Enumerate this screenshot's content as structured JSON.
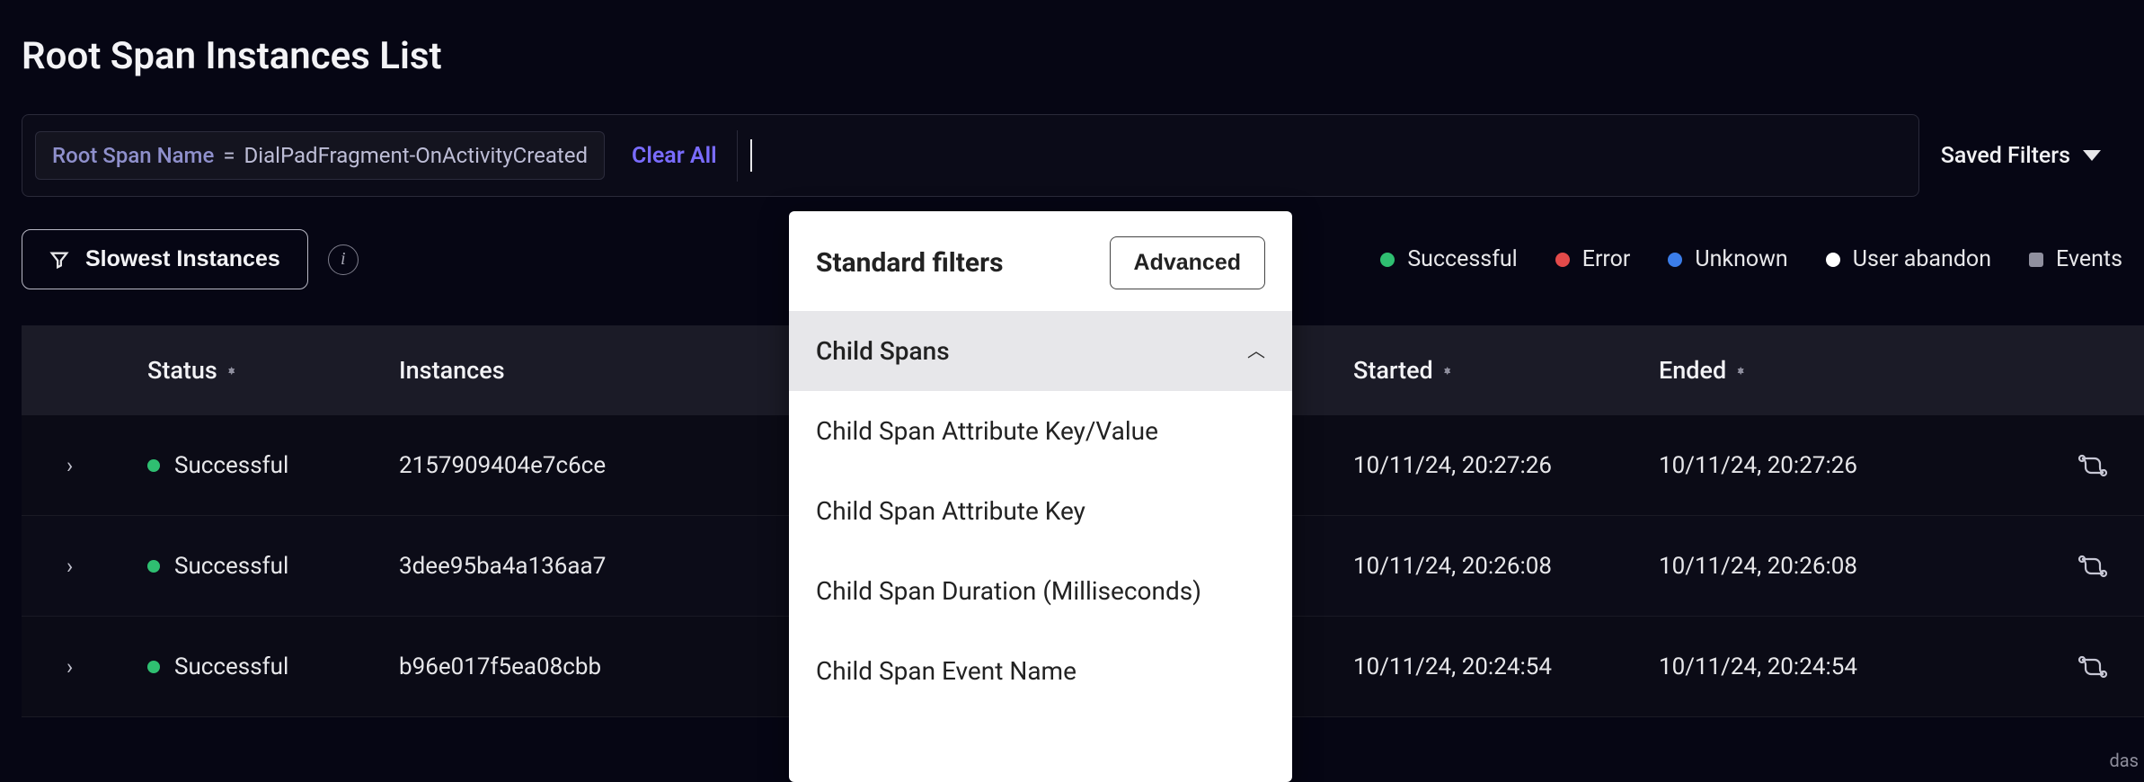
{
  "page_title": "Root Span Instances List",
  "filter_bar": {
    "chip": {
      "key": "Root Span Name",
      "op": "=",
      "value": "DialPadFragment-OnActivityCreated"
    },
    "clear_all": "Clear All"
  },
  "saved_filters": {
    "label": "Saved Filters"
  },
  "slowest_button": "Slowest Instances",
  "legend": {
    "successful": "Successful",
    "error": "Error",
    "unknown": "Unknown",
    "user_abandon": "User abandon",
    "events": "Events"
  },
  "colors": {
    "successful": "#2fbf71",
    "error": "#e34a4a",
    "unknown": "#3b7de9",
    "user_abandon": "#ffffff",
    "events": "#8f8f9e"
  },
  "table": {
    "headers": {
      "status": "Status",
      "instances": "Instances",
      "started": "Started",
      "ended": "Ended"
    },
    "rows": [
      {
        "status": "Successful",
        "instance_id": "2157909404e7c6ce",
        "started": "10/11/24, 20:27:26",
        "ended": "10/11/24, 20:27:26"
      },
      {
        "status": "Successful",
        "instance_id": "3dee95ba4a136aa7",
        "started": "10/11/24, 20:26:08",
        "ended": "10/11/24, 20:26:08"
      },
      {
        "status": "Successful",
        "instance_id": "b96e017f5ea08cbb",
        "started": "10/11/24, 20:24:54",
        "ended": "10/11/24, 20:24:54"
      }
    ]
  },
  "dropdown": {
    "title": "Standard filters",
    "advanced": "Advanced",
    "group": "Child Spans",
    "items": [
      "Child Span Attribute Key/Value",
      "Child Span Attribute Key",
      "Child Span Duration (Milliseconds)",
      "Child Span Event Name"
    ]
  },
  "bottom_right_label": "das"
}
